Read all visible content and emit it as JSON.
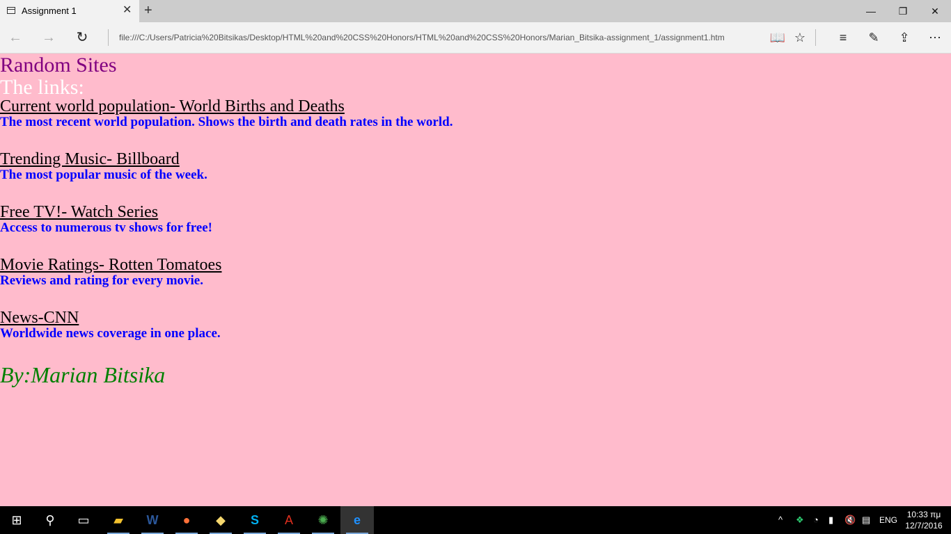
{
  "browser": {
    "tab_title": "Assignment 1",
    "address": "file:///C:/Users/Patricia%20Bitsikas/Desktop/HTML%20and%20CSS%20Honors/HTML%20and%20CSS%20Honors/Marian_Bitsika-assignment_1/assignment1.htm"
  },
  "page": {
    "title": "Random Sites",
    "subtitle": "The links:",
    "links": [
      {
        "label": "Current world population- World Births and Deaths",
        "desc": "The most recent world population. Shows the birth and death rates in the world."
      },
      {
        "label": "Trending Music- Billboard",
        "desc": "The most popular music of the week."
      },
      {
        "label": "Free TV!- Watch Series",
        "desc": "Access to numerous tv shows for free!"
      },
      {
        "label": "Movie Ratings- Rotten Tomatoes",
        "desc": "Reviews and rating for every movie."
      },
      {
        "label": "News-CNN",
        "desc": "Worldwide news coverage in one place."
      }
    ],
    "byline": "By:Marian Bitsika"
  },
  "taskbar": {
    "language": "ENG",
    "time": "10:33 πμ",
    "date": "12/7/2016"
  },
  "colors": {
    "page_background": "#ffbbcc",
    "title": "#800080",
    "subtitle": "#ffffff",
    "description": "#0000ff",
    "byline": "#008000"
  }
}
